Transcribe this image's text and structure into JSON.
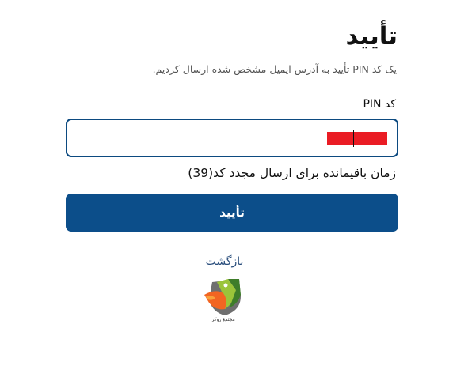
{
  "page": {
    "title": "تأیید",
    "subtitle": "یک کد PIN تأیید به آدرس ایمیل مشخص شده ارسال کردیم."
  },
  "form": {
    "pin_label": "کد PIN",
    "pin_value": "",
    "timer_text": "زمان باقیمانده برای ارسال مجدد کد",
    "timer_seconds": "(39)",
    "confirm_label": "تأیید",
    "back_label": "بازگشت"
  },
  "logo": {
    "icon": "brand-logo-icon",
    "caption": "مجتمع روکر"
  },
  "colors": {
    "primary": "#0c4e8a",
    "input_border": "#0c4a80",
    "link": "#2b4f7d",
    "redaction": "#ea1c24"
  }
}
